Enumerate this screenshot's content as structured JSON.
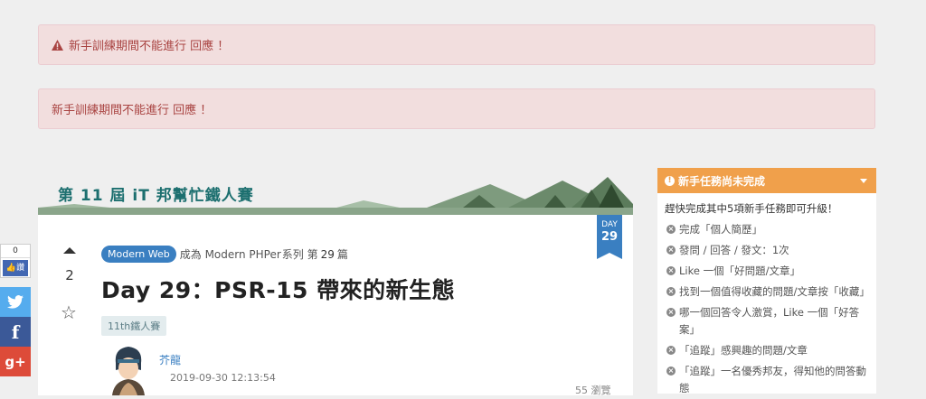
{
  "alerts": [
    {
      "text": "新手訓練期間不能進行 回應 ！",
      "icon": "warning-icon"
    },
    {
      "text": "新手訓練期間不能進行 回應 ！"
    }
  ],
  "share": {
    "like_count": "0",
    "like_label": "讚",
    "gplus_label": "g+"
  },
  "banner": {
    "title": "第 11 屆 iT 邦幫忙鐵人賽"
  },
  "post": {
    "vote_count": "2",
    "category": "Modern Web",
    "series_prefix": "成為 Modern PHPer",
    "series_suffix": "系列 第",
    "series_num": "29",
    "series_unit": "篇",
    "title": "Day 29：PSR-15 帶來的新生態",
    "tag": "11th鐵人賽",
    "author": "芥龍",
    "date": "2019-09-30 12:13:54",
    "views": "55 瀏覽",
    "day_label": "DAY",
    "day_num": "29"
  },
  "sidebar": {
    "header": "新手任務尚未完成",
    "intro": "趕快完成其中5項新手任務即可升級！",
    "tasks": [
      "完成「個人簡歷」",
      "發問 / 回答 / 發文：1次",
      "Like 一個「好問題/文章」",
      "找到一個值得收藏的問題/文章按「收藏」",
      "哪一個回答令人激賞，Like 一個「好答案」",
      "「追蹤」感興趣的問題/文章",
      "「追蹤」一名優秀邦友，得知他的問答動態"
    ]
  },
  "colors": {
    "accent": "#3a7fc1",
    "warning_bg": "#f2dede",
    "warning_text": "#a94442",
    "sidebar_header": "#f0a04b"
  }
}
